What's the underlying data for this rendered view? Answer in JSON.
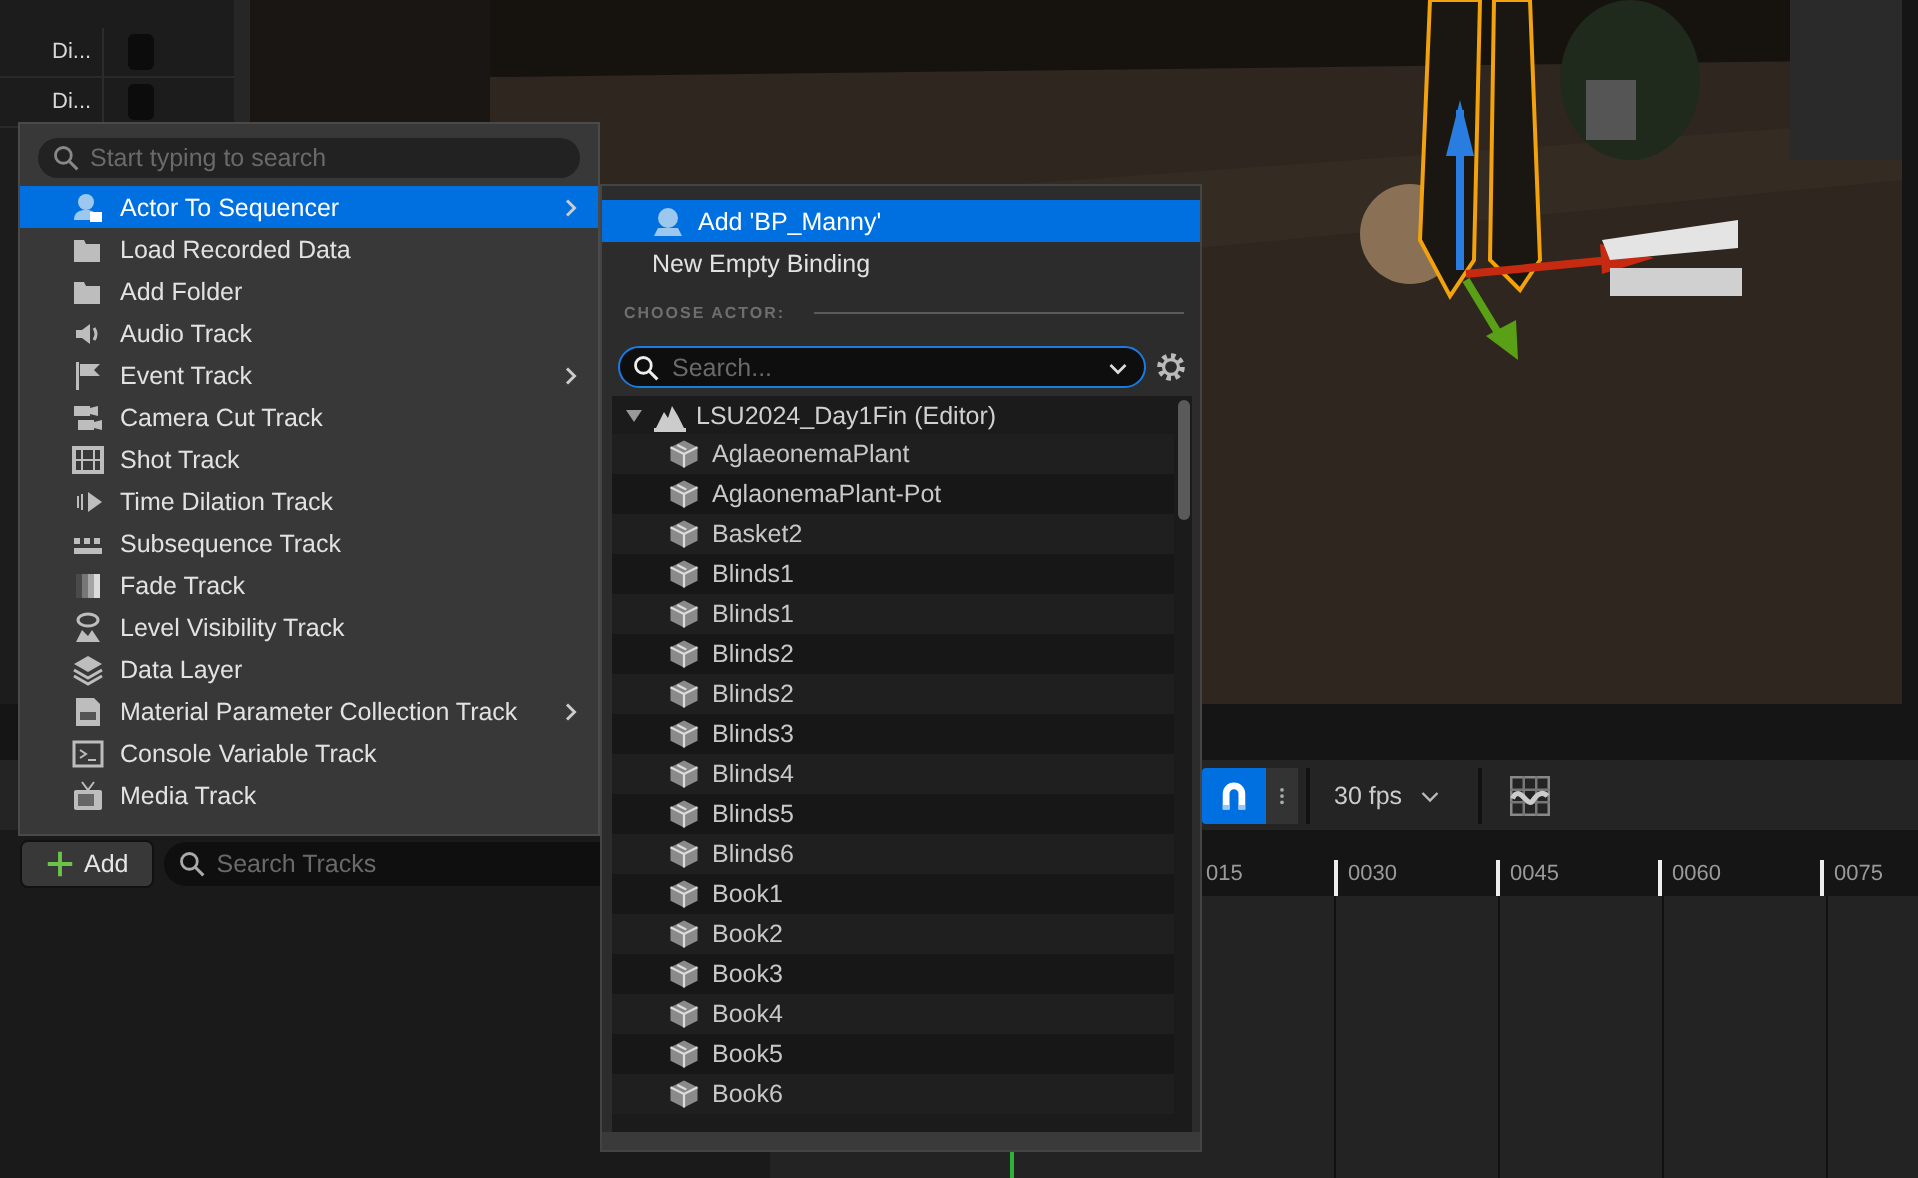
{
  "outliner": {
    "rows": [
      {
        "label": "Di..."
      },
      {
        "label": "Di..."
      }
    ]
  },
  "sequencer": {
    "snap": {
      "on": true
    },
    "frame_rate": "30 fps",
    "add_button": "Add",
    "search": {
      "placeholder": "Search Tracks"
    },
    "ruler": [
      "015",
      "0030",
      "0045",
      "0060",
      "0075"
    ]
  },
  "add_menu": {
    "search": {
      "placeholder": "Start typing to search"
    },
    "items": [
      {
        "label": "Actor To Sequencer",
        "has_submenu": true,
        "selected": true
      },
      {
        "label": "Load Recorded Data",
        "has_submenu": false,
        "selected": false
      },
      {
        "label": "Add Folder",
        "has_submenu": false,
        "selected": false
      },
      {
        "label": "Audio Track",
        "has_submenu": false,
        "selected": false
      },
      {
        "label": "Event Track",
        "has_submenu": true,
        "selected": false
      },
      {
        "label": "Camera Cut Track",
        "has_submenu": false,
        "selected": false
      },
      {
        "label": "Shot Track",
        "has_submenu": false,
        "selected": false
      },
      {
        "label": "Time Dilation Track",
        "has_submenu": false,
        "selected": false
      },
      {
        "label": "Subsequence Track",
        "has_submenu": false,
        "selected": false
      },
      {
        "label": "Fade Track",
        "has_submenu": false,
        "selected": false
      },
      {
        "label": "Level Visibility Track",
        "has_submenu": false,
        "selected": false
      },
      {
        "label": "Data Layer",
        "has_submenu": false,
        "selected": false
      },
      {
        "label": "Material Parameter Collection Track",
        "has_submenu": true,
        "selected": false
      },
      {
        "label": "Console Variable Track",
        "has_submenu": false,
        "selected": false
      },
      {
        "label": "Media Track",
        "has_submenu": false,
        "selected": false
      }
    ]
  },
  "actor_menu": {
    "items": [
      {
        "label": "Add 'BP_Manny'",
        "kind": "actor",
        "selected": true
      },
      {
        "label": "New Empty Binding",
        "kind": "plain",
        "selected": false
      }
    ],
    "section": "CHOOSE ACTOR:",
    "search": {
      "placeholder": "Search..."
    },
    "tree": {
      "label": "LSU2024_Day1Fin (Editor)",
      "expanded": true,
      "children": [
        {
          "label": "AglaeonemaPlant"
        },
        {
          "label": "AglaonemaPlant-Pot"
        },
        {
          "label": "Basket2"
        },
        {
          "label": "Blinds1"
        },
        {
          "label": "Blinds1"
        },
        {
          "label": "Blinds2"
        },
        {
          "label": "Blinds2"
        },
        {
          "label": "Blinds3"
        },
        {
          "label": "Blinds4"
        },
        {
          "label": "Blinds5"
        },
        {
          "label": "Blinds6"
        },
        {
          "label": "Book1"
        },
        {
          "label": "Book2"
        },
        {
          "label": "Book3"
        },
        {
          "label": "Book4"
        },
        {
          "label": "Book5"
        },
        {
          "label": "Book6"
        }
      ]
    }
  }
}
